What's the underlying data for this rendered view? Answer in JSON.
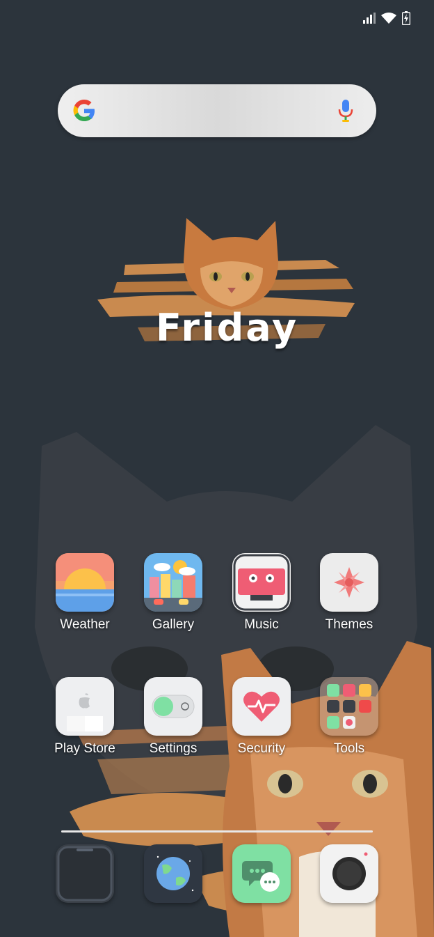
{
  "widget": {
    "text": "Friday"
  },
  "apps_row1": [
    {
      "label": "Weather",
      "icon": "weather-icon"
    },
    {
      "label": "Gallery",
      "icon": "gallery-icon"
    },
    {
      "label": "Music",
      "icon": "music-icon"
    },
    {
      "label": "Themes",
      "icon": "themes-icon"
    }
  ],
  "apps_row2": [
    {
      "label": "Play Store",
      "icon": "play-store-icon"
    },
    {
      "label": "Settings",
      "icon": "settings-toggle-icon"
    },
    {
      "label": "Security",
      "icon": "heart-pulse-icon"
    },
    {
      "label": "Tools",
      "icon": "folder-icon"
    }
  ],
  "dock": [
    {
      "icon": "phone-icon"
    },
    {
      "icon": "browser-globe-icon"
    },
    {
      "icon": "messages-icon"
    },
    {
      "icon": "camera-icon"
    }
  ],
  "colors": {
    "background": "#2c343c",
    "brush_orange": "#c98a4f"
  }
}
